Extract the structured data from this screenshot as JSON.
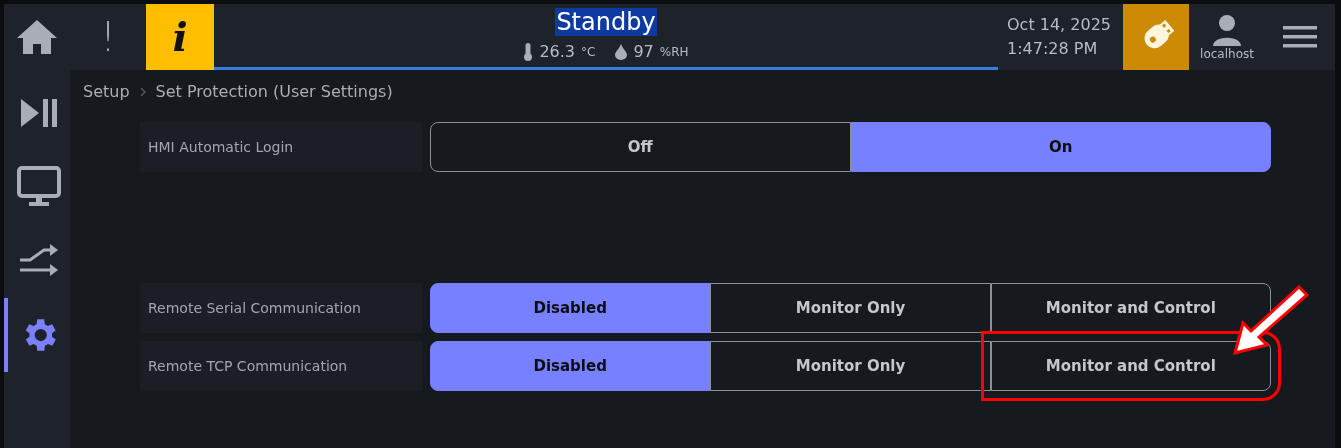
{
  "sidebar": {
    "items": [
      {
        "kind": "home",
        "selected": false
      },
      {
        "kind": "playpause",
        "selected": false
      },
      {
        "kind": "monitor",
        "selected": false
      },
      {
        "kind": "switch",
        "selected": false
      },
      {
        "kind": "settings",
        "selected": true
      }
    ]
  },
  "header": {
    "alert": "!",
    "info": "i",
    "status": "Standby",
    "temperature": "26.3",
    "temperature_unit": "°C",
    "humidity": "97",
    "humidity_unit": "%RH",
    "date": "Oct 14, 2025",
    "time": "1:47:28 PM",
    "user": "localhost"
  },
  "breadcrumb": [
    "Setup",
    "Set Protection (User Settings)"
  ],
  "settings": [
    {
      "label": "HMI Automatic Login",
      "options": [
        {
          "label": "Off",
          "selected": false
        },
        {
          "label": "On",
          "selected": true
        }
      ]
    },
    {
      "kind": "gap"
    },
    {
      "label": "Remote Serial Communication",
      "options": [
        {
          "label": "Disabled",
          "selected": true
        },
        {
          "label": "Monitor Only",
          "selected": false
        },
        {
          "label": "Monitor and Control",
          "selected": false
        }
      ]
    },
    {
      "label": "Remote TCP Communication",
      "options": [
        {
          "label": "Disabled",
          "selected": true
        },
        {
          "label": "Monitor Only",
          "selected": false
        },
        {
          "label": "Monitor and Control",
          "selected": false,
          "highlighted": true
        }
      ]
    }
  ]
}
